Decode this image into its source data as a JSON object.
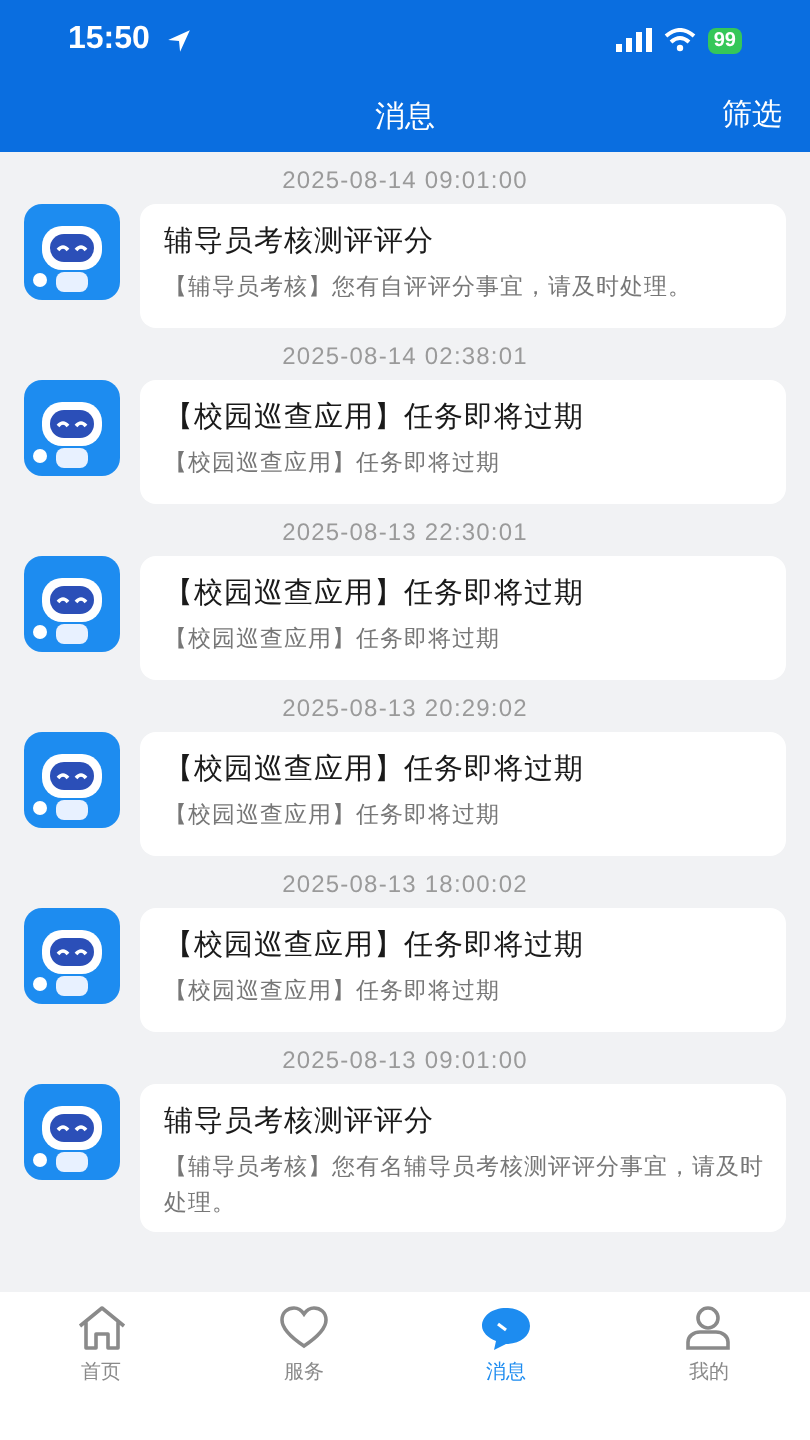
{
  "status_bar": {
    "time": "15:50",
    "battery": "99"
  },
  "header": {
    "title": "消息",
    "action": "筛选"
  },
  "messages": [
    {
      "time": "2025-08-14 09:01:00",
      "title": "辅导员考核测评评分",
      "body": "【辅导员考核】您有自评评分事宜，请及时处理。"
    },
    {
      "time": "2025-08-14 02:38:01",
      "title": "【校园巡查应用】任务即将过期",
      "body": "【校园巡查应用】任务即将过期"
    },
    {
      "time": "2025-08-13 22:30:01",
      "title": "【校园巡查应用】任务即将过期",
      "body": "【校园巡查应用】任务即将过期"
    },
    {
      "time": "2025-08-13 20:29:02",
      "title": "【校园巡查应用】任务即将过期",
      "body": "【校园巡查应用】任务即将过期"
    },
    {
      "time": "2025-08-13 18:00:02",
      "title": "【校园巡查应用】任务即将过期",
      "body": "【校园巡查应用】任务即将过期"
    },
    {
      "time": "2025-08-13 09:01:00",
      "title": "辅导员考核测评评分",
      "body": "【辅导员考核】您有名辅导员考核测评评分事宜，请及时处理。"
    }
  ],
  "tabbar": [
    {
      "kind": "home",
      "label": "首页",
      "selected": false
    },
    {
      "kind": "heart",
      "label": "服务",
      "selected": false
    },
    {
      "kind": "chat",
      "label": "消息",
      "selected": true
    },
    {
      "kind": "person",
      "label": "我的",
      "selected": false
    }
  ]
}
